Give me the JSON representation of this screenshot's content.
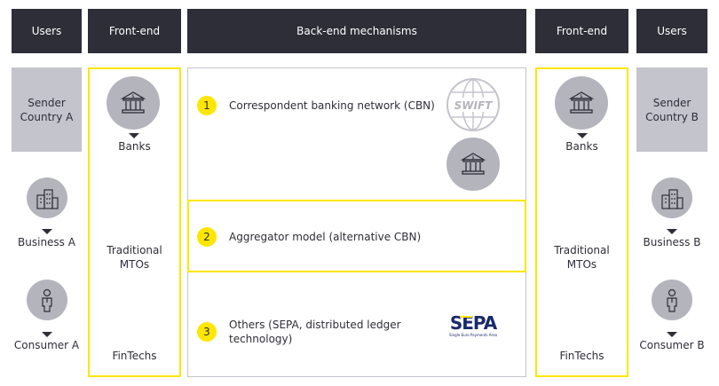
{
  "headers": {
    "users_left": "Users",
    "frontend_left": "Front-end",
    "backend": "Back-end mechanisms",
    "frontend_right": "Front-end",
    "users_right": "Users"
  },
  "left_users": {
    "sender": "Sender\nCountry A",
    "business": "Business A",
    "consumer": "Consumer A"
  },
  "right_users": {
    "sender": "Sender\nCountry B",
    "business": "Business B",
    "consumer": "Consumer B"
  },
  "frontend": {
    "banks": "Banks",
    "mtos": "Traditional\nMTOs",
    "fintechs": "FinTechs"
  },
  "mechanisms": [
    {
      "number": "1",
      "label": "Correspondent banking network (CBN)"
    },
    {
      "number": "2",
      "label": "Aggregator model (alternative CBN)"
    },
    {
      "number": "3",
      "label": "Others (SEPA, distributed ledger\ntechnology)"
    }
  ],
  "logos": {
    "swift": "SWIFT",
    "sepa": "SEPA",
    "sepa_sub": "Single Euro Payments Area"
  },
  "colors": {
    "dark": "#2e2e38",
    "yellow": "#ffe600",
    "gray": "#c4c4cd",
    "icon_gray": "#b4b4bc",
    "sepa_blue": "#1a2a6c"
  },
  "icons": [
    "bank-icon",
    "buildings-icon",
    "person-icon",
    "globe-icon"
  ]
}
